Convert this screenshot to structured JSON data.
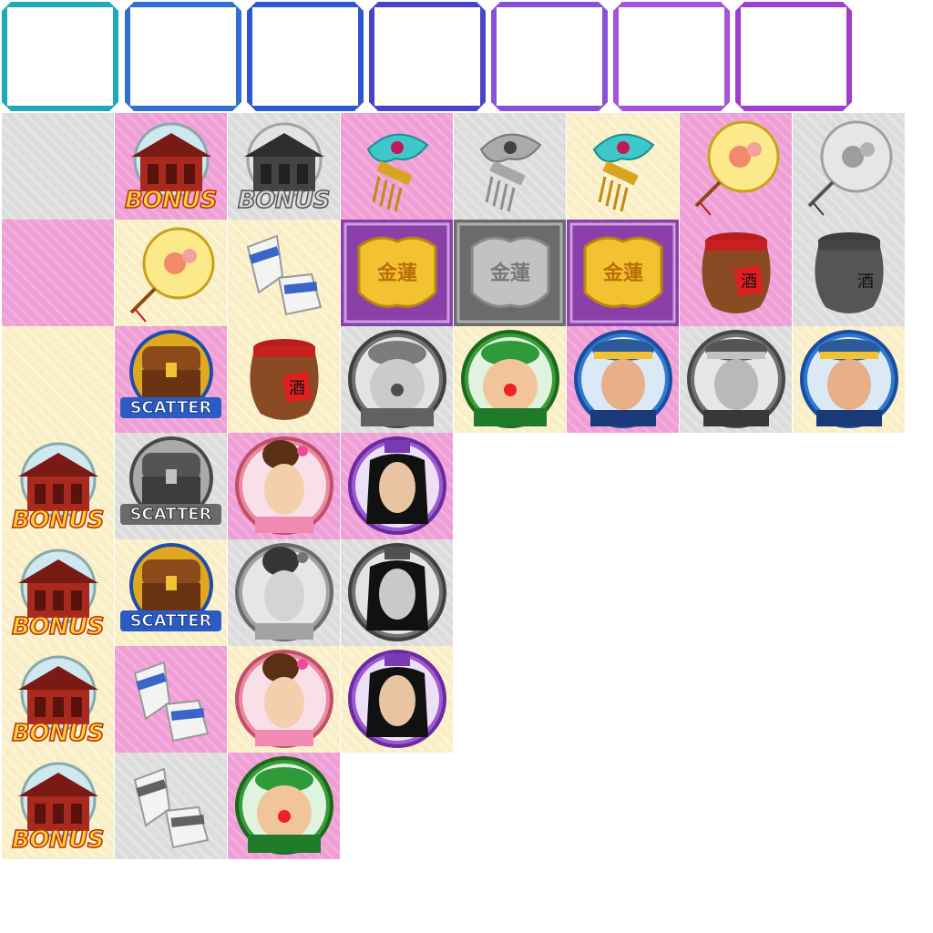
{
  "frames": [
    {
      "color": "#1fa8b8"
    },
    {
      "color": "#2f6fd0"
    },
    {
      "color": "#2f56cf"
    },
    {
      "color": "#4a45c8"
    },
    {
      "color": "#8a50d8"
    },
    {
      "color": "#a952d8"
    },
    {
      "color": "#a23ccf"
    }
  ],
  "labels": {
    "bonus": "BONUS",
    "scatter": "SCATTER",
    "wine_char": "酒",
    "plaque_chars": "金蓮"
  },
  "colors": {
    "tile_gray": "#dcdcdc",
    "tile_pink": "#ef9ed6",
    "tile_cream": "#f9eec4",
    "gold": "#f2c230",
    "red": "#c0321e"
  },
  "symbols": [
    "empty-gray",
    "house-bonus",
    "house-bonus-gray",
    "hairpin",
    "hairpin-gray",
    "hairpin",
    "fan",
    "fan-gray",
    "empty-pink",
    "fan",
    "shoes",
    "plaque",
    "plaque-gray",
    "plaque",
    "wine-jar",
    "wine-jar-gray",
    "empty-cream",
    "chest-scatter",
    "wine-jar",
    "fat-man-gray",
    "fat-man",
    "young-man",
    "young-man-gray",
    "young-man",
    "house-bonus",
    "chest-scatter-gray",
    "lady",
    "scholar",
    "house-bonus",
    "chest-scatter",
    "lady-gray",
    "scholar-gray",
    "house-bonus",
    "shoes",
    "lady",
    "scholar",
    "house-bonus",
    "shoes-gray",
    "fat-man"
  ]
}
